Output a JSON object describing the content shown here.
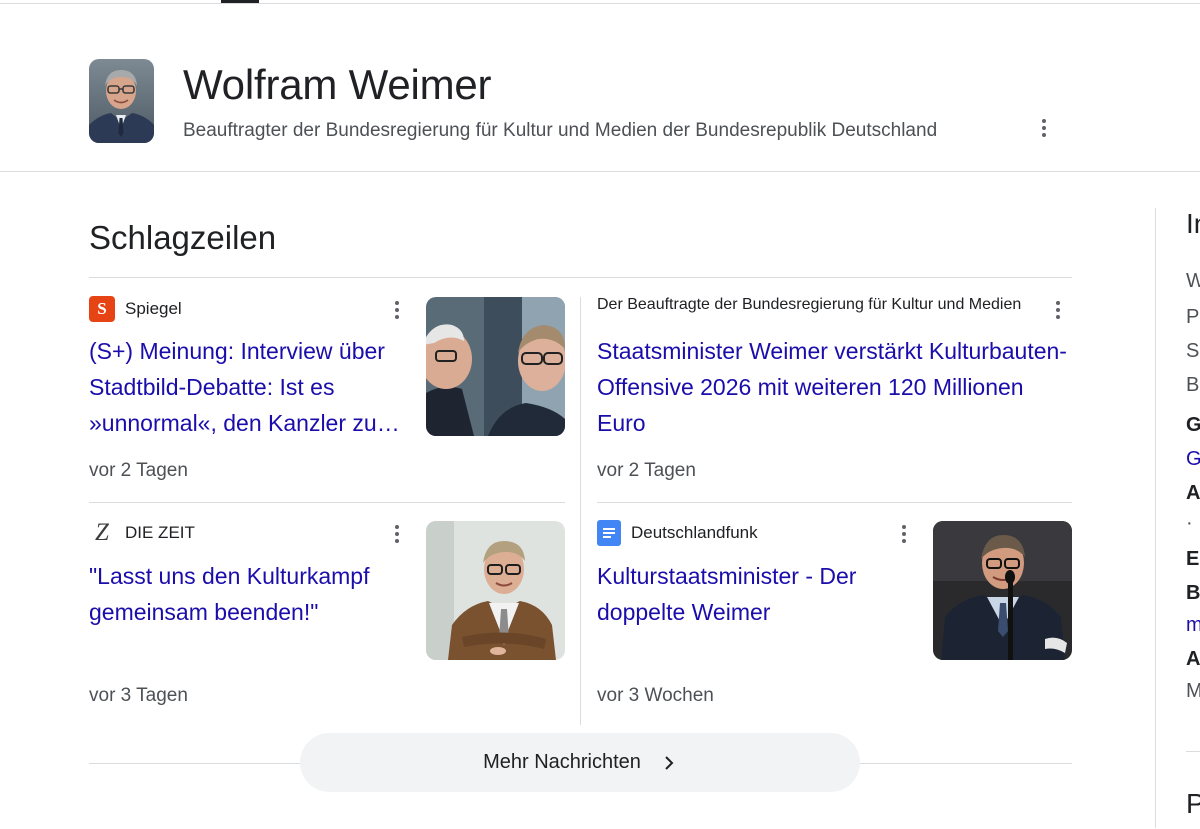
{
  "knowledge_panel": {
    "name": "Wolfram Weimer",
    "subtitle": "Beauftragter der Bundesregierung für Kultur und Medien der Bundesrepublik Deutschland"
  },
  "headlines": {
    "title": "Schlagzeilen",
    "cards": [
      {
        "source": "Spiegel",
        "source_icon": "spiegel-s-logo",
        "title": "(S+) Meinung: Interview über Stadtbild-Debatte: Ist es »unnormal«, den Kanzler zu kritisieren?",
        "time": "vor 2 Tagen"
      },
      {
        "source": "Der Beauftragte der Bundesregierung für Kultur und Medien",
        "title": "Staatsminister Weimer verstärkt Kulturbauten-Offensive 2026 mit weiteren 120 Millionen Euro",
        "time": "vor 2 Tagen"
      },
      {
        "source": "DIE ZEIT",
        "source_icon": "zeit-z-logo",
        "title": "\"Lasst uns den Kulturkampf gemeinsam beenden!\"",
        "time": "vor 3 Tagen"
      },
      {
        "source": "Deutschlandfunk",
        "source_icon": "deutschlandfunk-doc-logo",
        "title": "Kulturstaatsminister - Der doppelte Weimer",
        "time": "vor 3 Wochen"
      }
    ],
    "more_label": "Mehr Nachrichten"
  },
  "right_panel": {
    "lines": [
      "In",
      "W",
      "P",
      "S",
      "B",
      "G",
      "G",
      "A",
      "·",
      "E",
      "B",
      "m",
      "A",
      "M",
      "P"
    ]
  },
  "colors": {
    "link": "#1a0dab",
    "text": "#202124",
    "secondary": "#4d5156",
    "divider": "#dadce0",
    "spiegel_red": "#e64415",
    "dlf_blue": "#4285f4",
    "button_bg": "#f1f3f4"
  }
}
